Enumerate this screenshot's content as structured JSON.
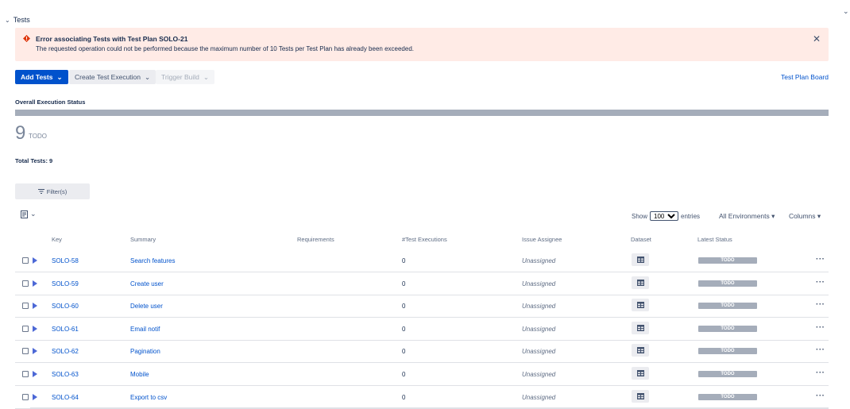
{
  "section": {
    "title": "Tests"
  },
  "banner": {
    "title": "Error associating Tests with Test Plan SOLO-21",
    "message": "The requested operation could not be performed because the maximum number of 10 Tests per Test Plan has already been exceeded."
  },
  "toolbar": {
    "add_tests": "Add Tests",
    "create_execution": "Create Test Execution",
    "trigger_build": "Trigger Build",
    "plan_board": "Test Plan Board"
  },
  "overall": {
    "label": "Overall Execution Status",
    "count": "9",
    "count_label": "TODO",
    "total": "Total Tests: 9",
    "progress_todo_fraction": 1.0
  },
  "filters": {
    "label": "Filter(s)"
  },
  "table_controls": {
    "show_label": "Show",
    "entries_value": "100",
    "entries_label": "entries",
    "environments": "All Environments",
    "columns": "Columns"
  },
  "table": {
    "headers": [
      "Key",
      "Summary",
      "Requirements",
      "#Test Executions",
      "Issue Assignee",
      "Dataset",
      "Latest Status"
    ],
    "rows": [
      {
        "key": "SOLO-58",
        "summary": "Search features",
        "executions": "0",
        "assignee": "Unassigned",
        "status": "TODO"
      },
      {
        "key": "SOLO-59",
        "summary": "Create user",
        "executions": "0",
        "assignee": "Unassigned",
        "status": "TODO"
      },
      {
        "key": "SOLO-60",
        "summary": "Delete user",
        "executions": "0",
        "assignee": "Unassigned",
        "status": "TODO"
      },
      {
        "key": "SOLO-61",
        "summary": "Email notif",
        "executions": "0",
        "assignee": "Unassigned",
        "status": "TODO"
      },
      {
        "key": "SOLO-62",
        "summary": "Pagination",
        "executions": "0",
        "assignee": "Unassigned",
        "status": "TODO"
      },
      {
        "key": "SOLO-63",
        "summary": "Mobile",
        "executions": "0",
        "assignee": "Unassigned",
        "status": "TODO"
      },
      {
        "key": "SOLO-64",
        "summary": "Export to csv",
        "executions": "0",
        "assignee": "Unassigned",
        "status": "TODO"
      }
    ]
  },
  "colors": {
    "primary": "#0052cc",
    "error_bg": "#ffebe6",
    "error_icon": "#de350b",
    "todo": "#a5adba",
    "play": "#4c68d6"
  },
  "icons": [
    "chevron-down-icon",
    "error-icon",
    "close-icon",
    "filter-icon",
    "list-icon",
    "play-icon",
    "table-icon",
    "more-icon"
  ]
}
